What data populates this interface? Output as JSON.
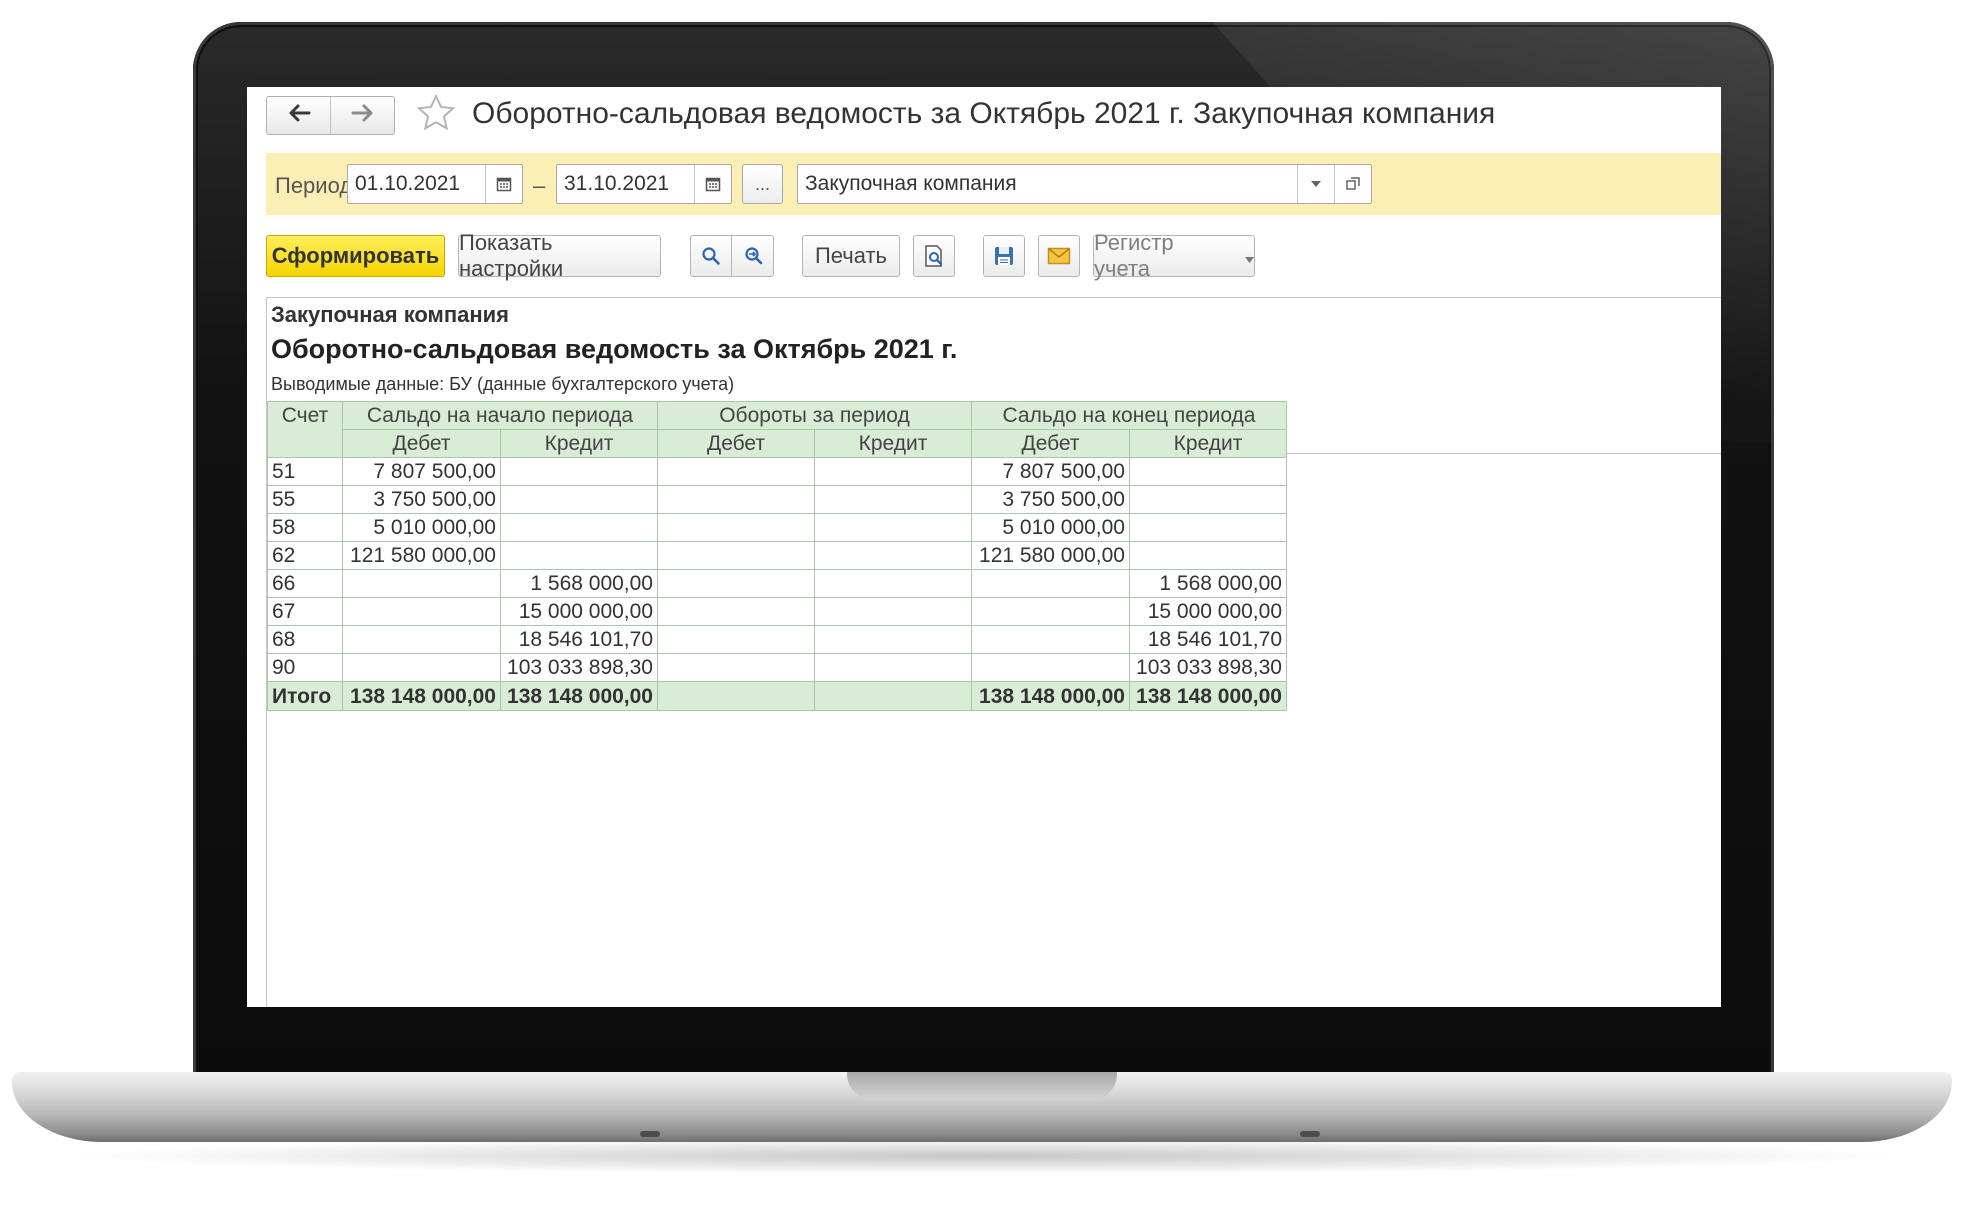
{
  "window": {
    "title": "Оборотно-сальдовая ведомость за Октябрь 2021 г. Закупочная компания"
  },
  "period_bar": {
    "label": "Период:",
    "date_from": "01.10.2021",
    "separator": "–",
    "date_to": "31.10.2021",
    "more_label": "...",
    "organization": "Закупочная компания"
  },
  "toolbar": {
    "generate_label": "Сформировать",
    "settings_label": "Показать настройки",
    "print_label": "Печать",
    "register_label": "Регистр учета"
  },
  "icons": {
    "back": "arrow-left-icon",
    "forward": "arrow-right-icon",
    "favorite": "star-icon",
    "calendar": "calendar-icon",
    "dropdown": "chevron-down-icon",
    "open": "open-window-icon",
    "search": "search-icon",
    "search_again": "search-refresh-icon",
    "preview": "print-preview-icon",
    "save": "floppy-disk-icon",
    "mail": "envelope-icon"
  },
  "colors": {
    "accent_yellow": "#f5d400",
    "period_bar_bg": "#fbefb6",
    "table_header_bg": "#d9ecd6",
    "table_border": "#a9c8a9"
  },
  "report": {
    "company": "Закупочная компания",
    "title": "Оборотно-сальдовая ведомость за Октябрь 2021 г.",
    "params": "Выводимые данные:  БУ (данные бухгалтерского учета)",
    "headers": {
      "account": "Счет",
      "opening": "Сальдо на начало периода",
      "turnover": "Обороты за период",
      "closing": "Сальдо на конец периода",
      "debit": "Дебет",
      "credit": "Кредит"
    },
    "rows": [
      {
        "account": "51",
        "open_debit": "7 807 500,00",
        "open_credit": "",
        "turn_debit": "",
        "turn_credit": "",
        "close_debit": "7 807 500,00",
        "close_credit": ""
      },
      {
        "account": "55",
        "open_debit": "3 750 500,00",
        "open_credit": "",
        "turn_debit": "",
        "turn_credit": "",
        "close_debit": "3 750 500,00",
        "close_credit": ""
      },
      {
        "account": "58",
        "open_debit": "5 010 000,00",
        "open_credit": "",
        "turn_debit": "",
        "turn_credit": "",
        "close_debit": "5 010 000,00",
        "close_credit": ""
      },
      {
        "account": "62",
        "open_debit": "121 580 000,00",
        "open_credit": "",
        "turn_debit": "",
        "turn_credit": "",
        "close_debit": "121 580 000,00",
        "close_credit": ""
      },
      {
        "account": "66",
        "open_debit": "",
        "open_credit": "1 568 000,00",
        "turn_debit": "",
        "turn_credit": "",
        "close_debit": "",
        "close_credit": "1 568 000,00"
      },
      {
        "account": "67",
        "open_debit": "",
        "open_credit": "15 000 000,00",
        "turn_debit": "",
        "turn_credit": "",
        "close_debit": "",
        "close_credit": "15 000 000,00"
      },
      {
        "account": "68",
        "open_debit": "",
        "open_credit": "18 546 101,70",
        "turn_debit": "",
        "turn_credit": "",
        "close_debit": "",
        "close_credit": "18 546 101,70"
      },
      {
        "account": "90",
        "open_debit": "",
        "open_credit": "103 033 898,30",
        "turn_debit": "",
        "turn_credit": "",
        "close_debit": "",
        "close_credit": "103 033 898,30"
      }
    ],
    "total": {
      "account": "Итого",
      "open_debit": "138 148 000,00",
      "open_credit": "138 148 000,00",
      "turn_debit": "",
      "turn_credit": "",
      "close_debit": "138 148 000,00",
      "close_credit": "138 148 000,00"
    }
  }
}
